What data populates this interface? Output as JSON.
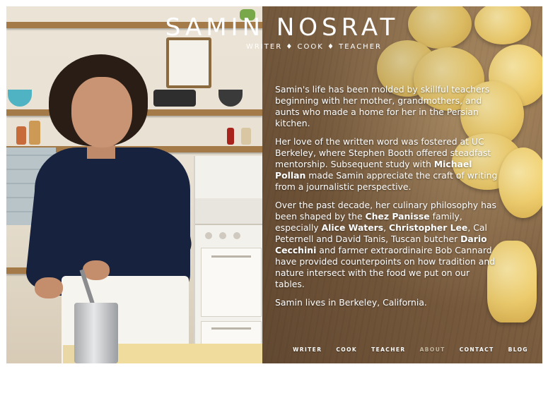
{
  "header": {
    "title": "SAMIN NOSRAT",
    "tagline": "WRITER ♦ COOK ♦ TEACHER"
  },
  "bio": {
    "p1": "Samin's life has been molded by skillful teachers beginning with her mother, grandmothers, and aunts who made a home for her in the Persian kitchen.",
    "p2_a": "Her love of the written word was fostered at UC Berkeley, where Stephen Booth offered steadfast mentorship. Subsequent study with ",
    "p2_b": "Michael Pollan",
    "p2_c": " made Samin appreciate the craft of writing from a journalistic perspective.",
    "p3_a": "Over the past decade, her culinary philosophy has been shaped by the ",
    "p3_b": "Chez Panisse",
    "p3_c": " family, especially ",
    "p3_d": "Alice Waters",
    "p3_e": ", ",
    "p3_f": "Christopher Lee",
    "p3_g": ", Cal Peternell and David Tanis, Tuscan butcher ",
    "p3_h": "Dario Cecchini",
    "p3_i": " and farmer extraordinaire Bob Cannard have provided counterpoints on how tradition and nature intersect with the food we put on our tables.",
    "p4": "Samin lives in Berkeley, California."
  },
  "nav": {
    "items": [
      "WRITER",
      "COOK",
      "TEACHER",
      "ABOUT",
      "CONTACT",
      "BLOG"
    ],
    "active": "ABOUT"
  },
  "colors": {
    "nav_active": "#c7b99f",
    "text": "#ffffff"
  }
}
